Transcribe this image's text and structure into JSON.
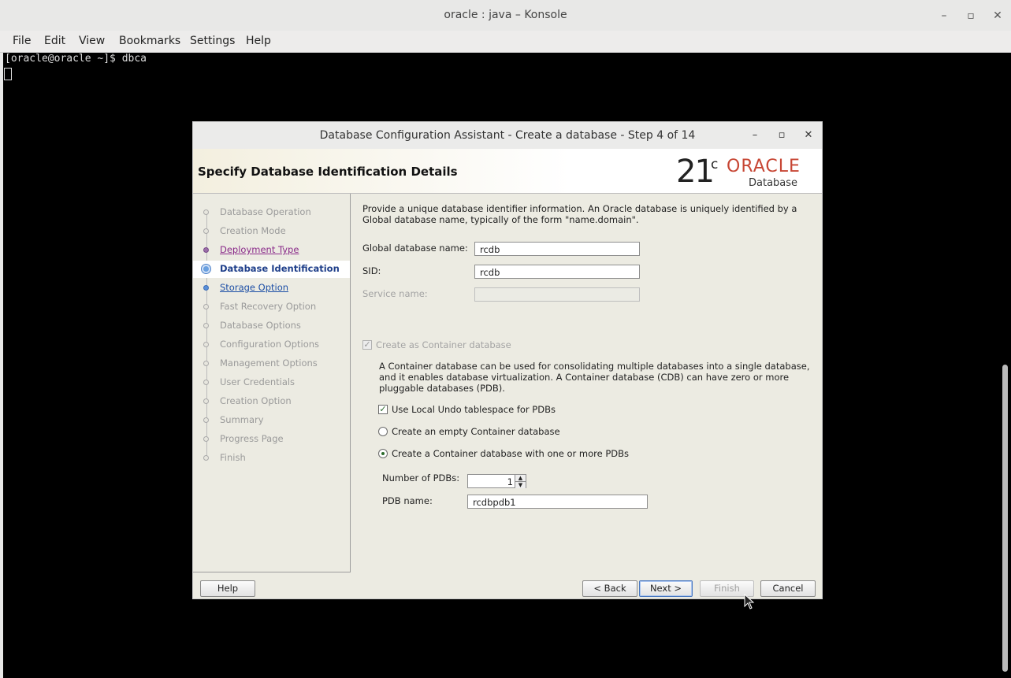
{
  "konsole": {
    "title": "oracle : java – Konsole",
    "menu": [
      "File",
      "Edit",
      "View",
      "Bookmarks",
      "Settings",
      "Help"
    ],
    "prompt": "[oracle@oracle ~]$ dbca"
  },
  "dialog": {
    "title": "Database Configuration Assistant - Create a database - Step 4 of 14",
    "header": "Specify Database Identification Details",
    "logo": {
      "version": "21",
      "suffix": "c",
      "brand": "ORACLE",
      "product": "Database"
    },
    "nav": [
      {
        "label": "Database Operation",
        "state": "disabled"
      },
      {
        "label": "Creation Mode",
        "state": "disabled"
      },
      {
        "label": "Deployment Type",
        "state": "visited"
      },
      {
        "label": "Database Identification",
        "state": "current"
      },
      {
        "label": "Storage Option",
        "state": "link"
      },
      {
        "label": "Fast Recovery Option",
        "state": "disabled"
      },
      {
        "label": "Database Options",
        "state": "disabled"
      },
      {
        "label": "Configuration Options",
        "state": "disabled"
      },
      {
        "label": "Management Options",
        "state": "disabled"
      },
      {
        "label": "User Credentials",
        "state": "disabled"
      },
      {
        "label": "Creation Option",
        "state": "disabled"
      },
      {
        "label": "Summary",
        "state": "disabled"
      },
      {
        "label": "Progress Page",
        "state": "disabled"
      },
      {
        "label": "Finish",
        "state": "disabled"
      }
    ],
    "description": "Provide a unique database identifier information. An Oracle database is uniquely identified by a Global database name, typically of the form \"name.domain\".",
    "global_db_label": "Global database name:",
    "global_db_value": "rcdb",
    "sid_label": "SID:",
    "sid_value": "rcdb",
    "service_label": "Service name:",
    "service_value": "",
    "container_checkbox_label": "Create as Container database",
    "container_desc": "A Container database can be used for consolidating multiple databases into a single database, and it enables database virtualization. A Container database (CDB) can have zero or more pluggable databases (PDB).",
    "local_undo_label": "Use Local Undo tablespace for PDBs",
    "empty_cdb_label": "Create an empty Container database",
    "cdb_with_pdbs_label": "Create a Container database with one or more PDBs",
    "num_pdbs_label": "Number of PDBs:",
    "num_pdbs_value": "1",
    "pdb_name_label": "PDB name:",
    "pdb_name_value": "rcdbpdb1",
    "buttons": {
      "help": "Help",
      "back": "< Back",
      "next": "Next >",
      "finish": "Finish",
      "cancel": "Cancel"
    }
  }
}
